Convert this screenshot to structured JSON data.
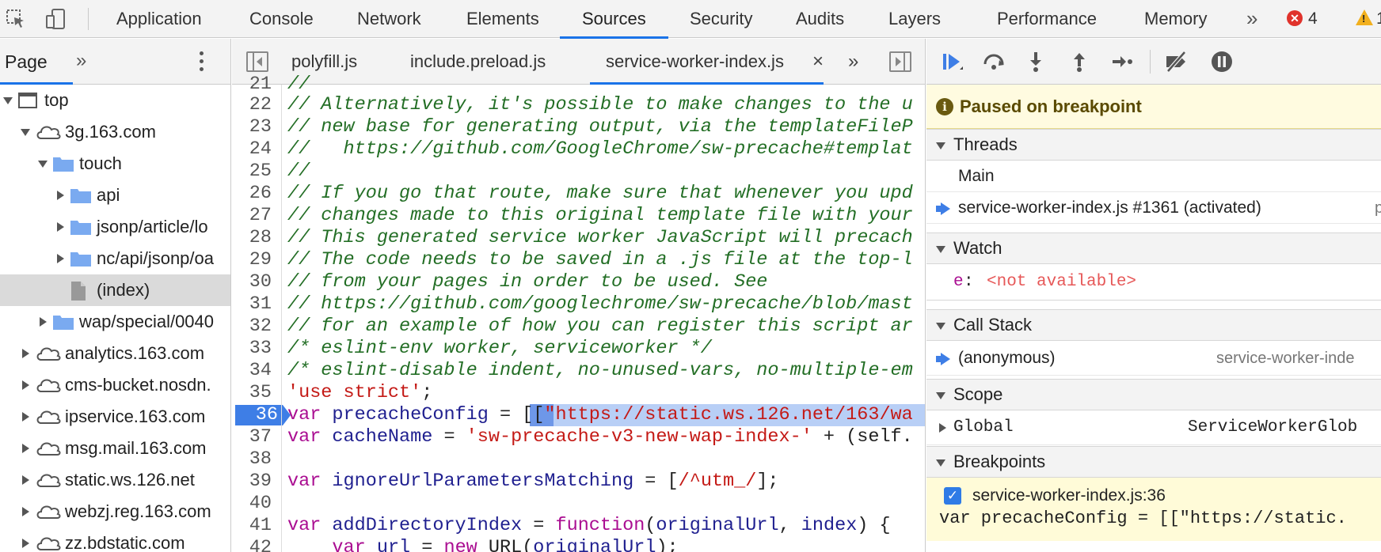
{
  "toolbar": {
    "tabs": [
      "Application",
      "Console",
      "Network",
      "Elements",
      "Sources",
      "Security",
      "Audits",
      "Layers",
      "Performance",
      "Memory"
    ],
    "active_tab": "Sources",
    "overflow": "»",
    "error_count": "4",
    "warning_count": "1",
    "error_glyph": "✕",
    "warning_glyph": "!"
  },
  "navigator": {
    "tab": "Page",
    "more": "»",
    "tree": [
      {
        "label": "top",
        "depth": 0,
        "type": "frame",
        "expanded": true
      },
      {
        "label": "3g.163.com",
        "depth": 1,
        "type": "cloud",
        "expanded": true
      },
      {
        "label": "touch",
        "depth": 2,
        "type": "folder",
        "expanded": true
      },
      {
        "label": "api",
        "depth": 3,
        "type": "folder",
        "expanded": false
      },
      {
        "label": "jsonp/article/lo",
        "depth": 3,
        "type": "folder",
        "expanded": false
      },
      {
        "label": "nc/api/jsonp/oa",
        "depth": 3,
        "type": "folder",
        "expanded": false
      },
      {
        "label": "(index)",
        "depth": 3,
        "type": "file",
        "selected": true
      },
      {
        "label": "wap/special/0040",
        "depth": 2,
        "type": "folder",
        "expanded": false
      },
      {
        "label": "analytics.163.com",
        "depth": 1,
        "type": "cloud",
        "expanded": false
      },
      {
        "label": "cms-bucket.nosdn.",
        "depth": 1,
        "type": "cloud",
        "expanded": false
      },
      {
        "label": "ipservice.163.com",
        "depth": 1,
        "type": "cloud",
        "expanded": false
      },
      {
        "label": "msg.mail.163.com",
        "depth": 1,
        "type": "cloud",
        "expanded": false
      },
      {
        "label": "static.ws.126.net",
        "depth": 1,
        "type": "cloud",
        "expanded": false
      },
      {
        "label": "webzj.reg.163.com",
        "depth": 1,
        "type": "cloud",
        "expanded": false
      },
      {
        "label": "zz.bdstatic.com",
        "depth": 1,
        "type": "cloud",
        "expanded": false
      }
    ]
  },
  "editor": {
    "tabs": [
      "polyfill.js",
      "include.preload.js",
      "service-worker-index.js"
    ],
    "active_tab": "service-worker-index.js",
    "close_glyph": "×",
    "more": "»",
    "lines": [
      {
        "n": "21",
        "parts": [
          {
            "t": "//",
            "c": "com"
          }
        ]
      },
      {
        "n": "22",
        "parts": [
          {
            "t": "// Alternatively, it's possible to make changes to the u",
            "c": "com"
          }
        ]
      },
      {
        "n": "23",
        "parts": [
          {
            "t": "// new base for generating output, via the templateFileP",
            "c": "com"
          }
        ]
      },
      {
        "n": "24",
        "parts": [
          {
            "t": "//   https://github.com/GoogleChrome/sw-precache#templat",
            "c": "com"
          }
        ]
      },
      {
        "n": "25",
        "parts": [
          {
            "t": "//",
            "c": "com"
          }
        ]
      },
      {
        "n": "26",
        "parts": [
          {
            "t": "// If you go that route, make sure that whenever you upd",
            "c": "com"
          }
        ]
      },
      {
        "n": "27",
        "parts": [
          {
            "t": "// changes made to this original template file with your",
            "c": "com"
          }
        ]
      },
      {
        "n": "28",
        "parts": [
          {
            "t": "// This generated service worker JavaScript will precach",
            "c": "com"
          }
        ]
      },
      {
        "n": "29",
        "parts": [
          {
            "t": "// The code needs to be saved in a .js file at the top-l",
            "c": "com"
          }
        ]
      },
      {
        "n": "30",
        "parts": [
          {
            "t": "// from your pages in order to be used. See",
            "c": "com"
          }
        ]
      },
      {
        "n": "31",
        "parts": [
          {
            "t": "// https://github.com/googlechrome/sw-precache/blob/mast",
            "c": "com"
          }
        ]
      },
      {
        "n": "32",
        "parts": [
          {
            "t": "// for an example of how you can register this script ar",
            "c": "com"
          }
        ]
      },
      {
        "n": "33",
        "parts": [
          {
            "t": "/* eslint-env worker, serviceworker */",
            "c": "com"
          }
        ]
      },
      {
        "n": "34",
        "parts": [
          {
            "t": "/* eslint-disable indent, no-unused-vars, no-multiple-em",
            "c": "com"
          }
        ]
      },
      {
        "n": "35",
        "parts": [
          {
            "t": "'use strict'",
            "c": "str"
          },
          {
            "t": ";",
            "c": "plain"
          }
        ]
      },
      {
        "n": "36",
        "bp": true,
        "parts": [
          {
            "t": "var",
            "c": "key"
          },
          {
            "t": " ",
            "c": "plain"
          },
          {
            "t": "precacheConfig",
            "c": "id"
          },
          {
            "t": " = [[",
            "c": "plain"
          },
          {
            "t": "\"https://static.ws.126.net/163/wa",
            "c": "str"
          }
        ]
      },
      {
        "n": "37",
        "parts": [
          {
            "t": "var",
            "c": "key"
          },
          {
            "t": " ",
            "c": "plain"
          },
          {
            "t": "cacheName",
            "c": "id"
          },
          {
            "t": " = ",
            "c": "plain"
          },
          {
            "t": "'sw-precache-v3-new-wap-index-'",
            "c": "str"
          },
          {
            "t": " + (self.",
            "c": "plain"
          }
        ]
      },
      {
        "n": "38",
        "parts": []
      },
      {
        "n": "39",
        "parts": [
          {
            "t": "var",
            "c": "key"
          },
          {
            "t": " ",
            "c": "plain"
          },
          {
            "t": "ignoreUrlParametersMatching",
            "c": "id"
          },
          {
            "t": " = [",
            "c": "plain"
          },
          {
            "t": "/^utm_/",
            "c": "str"
          },
          {
            "t": "];",
            "c": "plain"
          }
        ]
      },
      {
        "n": "40",
        "parts": []
      },
      {
        "n": "41",
        "parts": [
          {
            "t": "var",
            "c": "key"
          },
          {
            "t": " ",
            "c": "plain"
          },
          {
            "t": "addDirectoryIndex",
            "c": "id"
          },
          {
            "t": " = ",
            "c": "plain"
          },
          {
            "t": "function",
            "c": "key"
          },
          {
            "t": "(",
            "c": "plain"
          },
          {
            "t": "originalUrl",
            "c": "id"
          },
          {
            "t": ", ",
            "c": "plain"
          },
          {
            "t": "index",
            "c": "id"
          },
          {
            "t": ") {",
            "c": "plain"
          }
        ]
      },
      {
        "n": "42",
        "parts": [
          {
            "t": "    ",
            "c": "plain"
          },
          {
            "t": "var",
            "c": "key"
          },
          {
            "t": " ",
            "c": "plain"
          },
          {
            "t": "url",
            "c": "id"
          },
          {
            "t": " = ",
            "c": "plain"
          },
          {
            "t": "new",
            "c": "key"
          },
          {
            "t": " URL(",
            "c": "plain"
          },
          {
            "t": "originalUrl",
            "c": "id"
          },
          {
            "t": ");",
            "c": "plain"
          }
        ]
      }
    ]
  },
  "debugger": {
    "paused_message": "Paused on breakpoint",
    "threads": {
      "title": "Threads",
      "items": [
        {
          "label": "Main",
          "current": false
        },
        {
          "label": "service-worker-index.js #1361 (activated)",
          "current": true,
          "right": "p"
        }
      ]
    },
    "watch": {
      "title": "Watch",
      "expr_name": "e",
      "expr_sep": ":",
      "expr_value": "<not available>"
    },
    "call_stack": {
      "title": "Call Stack",
      "items": [
        {
          "label": "(anonymous)",
          "location": "service-worker-inde"
        }
      ]
    },
    "scope": {
      "title": "Scope",
      "items": [
        {
          "label": "Global",
          "value": "ServiceWorkerGlob"
        }
      ]
    },
    "breakpoints": {
      "title": "Breakpoints",
      "items": [
        {
          "label": "service-worker-index.js:36",
          "code": "var precacheConfig = [[\"https://static."
        }
      ],
      "check_glyph": "✓"
    }
  },
  "colors": {
    "accent": "#1a73e8",
    "breakpoint": "#3e7ee6",
    "paused_bg": "#fffbe0"
  }
}
